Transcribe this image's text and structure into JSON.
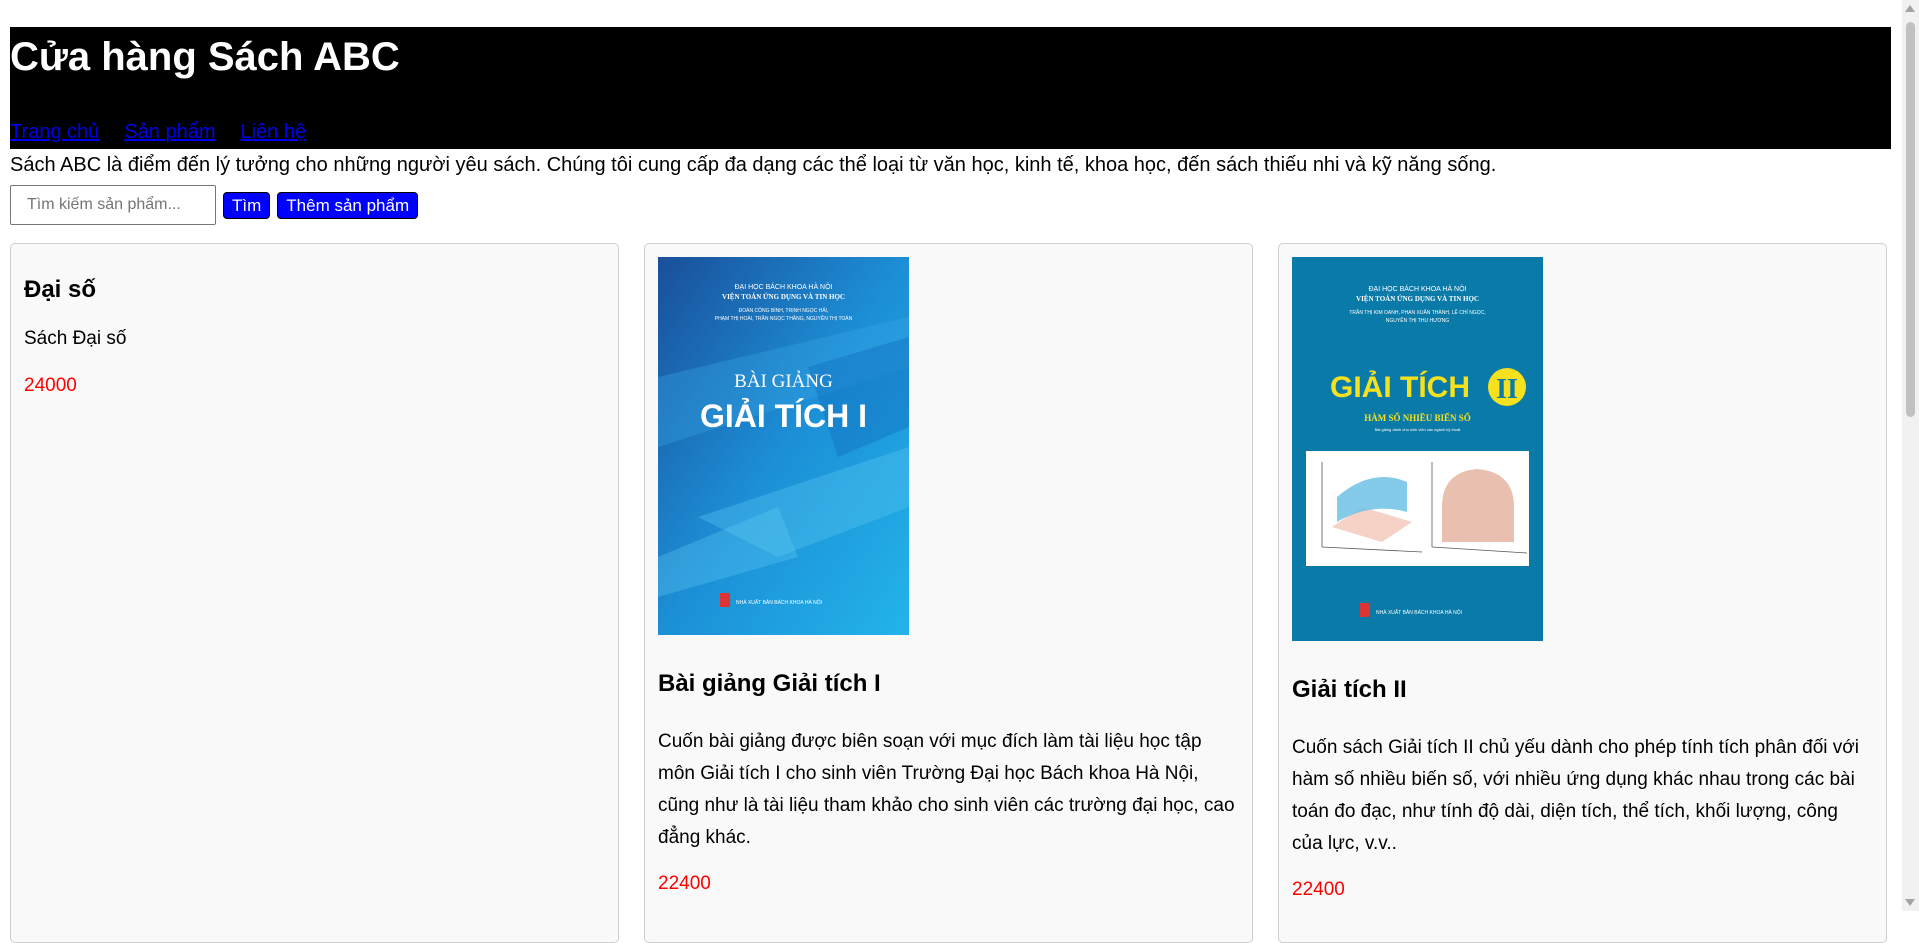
{
  "header": {
    "title": "Cửa hàng Sách ABC",
    "nav": [
      "Trang chủ",
      "Sản phẩm",
      "Liên hệ"
    ]
  },
  "intro": "Sách ABC là điểm đến lý tưởng cho những người yêu sách. Chúng tôi cung cấp đa dạng các thể loại từ văn học, kinh tế, khoa học, đến sách thiếu nhi và kỹ năng sống.",
  "search": {
    "placeholder": "Tìm kiếm sản phẩm...",
    "value": "",
    "search_label": "Tìm",
    "add_label": "Thêm sản phẩm"
  },
  "products": [
    {
      "title": "Đại số",
      "description": "Sách Đại số",
      "price": "24000"
    },
    {
      "title": "Bài giảng Giải tích I",
      "description": "Cuốn bài giảng được biên soạn với mục đích làm tài liệu học tập môn Giải tích I cho sinh viên Trường Đại học Bách khoa Hà Nội, cũng như là tài liệu tham khảo cho sinh viên các trường đại học, cao đẳng khác.",
      "price": "22400",
      "cover": {
        "school": "ĐẠI HỌC BÁCH KHOA HÀ NỘI",
        "institute": "VIỆN TOÁN ỨNG DỤNG VÀ TIN HỌC",
        "authors1": "ĐOÀN CÔNG BÌNH, TRỊNH NGỌC HẢI,",
        "authors2": "PHẠM THỊ HOÀI, TRẦN NGỌC THĂNG, NGUYỄN THỊ TOÀN",
        "line1": "BÀI GIẢNG",
        "line2": "GIẢI TÍCH I",
        "publisher": "NHÀ XUẤT BẢN BÁCH KHOA HÀ NỘI"
      }
    },
    {
      "title": "Giải tích II",
      "description": "Cuốn sách Giải tích II chủ yếu dành cho phép tính tích phân đối với hàm số nhiều biến số, với nhiều ứng dụng khác nhau trong các bài toán đo đạc, như tính độ dài, diện tích, thể tích, khối lượng, công của lực, v.v..",
      "price": "22400",
      "cover": {
        "school": "ĐẠI HỌC BÁCH KHOA HÀ NỘI",
        "institute": "VIỆN TOÁN ỨNG DỤNG VÀ TIN HỌC",
        "authors1": "TRẦN THỊ KIM OANH, PHAN XUÂN THÀNH, LÊ CHÍ NGỌC,",
        "authors2": "NGUYỄN THỊ THU HƯƠNG",
        "big": "GIẢI TÍCH",
        "numeral": "II",
        "subtitle": "HÀM SỐ NHIỀU BIẾN SỐ",
        "note": "Bài giảng dành cho sinh viên các ngành kỹ thuật",
        "publisher": "NHÀ XUẤT BẢN BÁCH KHOA HÀ NỘI"
      }
    }
  ]
}
